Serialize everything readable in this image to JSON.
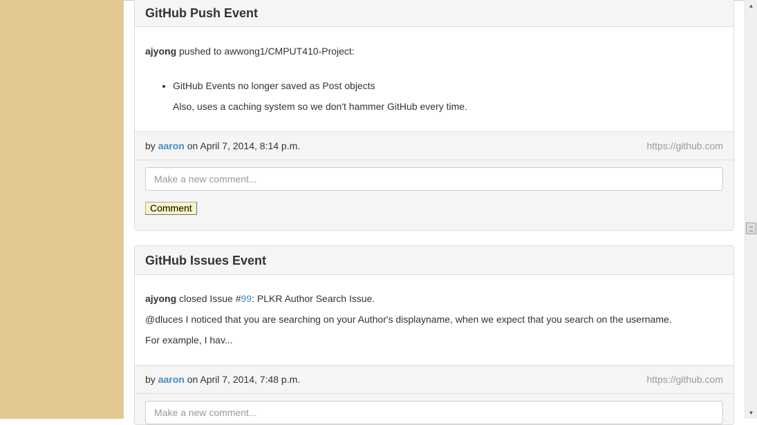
{
  "posts": [
    {
      "title": "GitHub Push Event",
      "actor": "ajyong",
      "action_text": " pushed to awwong1/CMPUT410-Project:",
      "commit_message": "GitHub Events no longer saved as Post objects",
      "commit_detail": "Also, uses a caching system so we don't hammer GitHub every time.",
      "by_label": "by ",
      "author": "aaron",
      "date_text": " on April 7, 2014, 8:14 p.m.",
      "source": "https://github.com",
      "comment_placeholder": "Make a new comment...",
      "comment_button": "Comment"
    },
    {
      "title": "GitHub Issues Event",
      "actor": "ajyong",
      "action_prefix": " closed Issue #",
      "issue_number": "99",
      "action_suffix": ": PLKR Author Search Issue.",
      "body_line_2": "@dluces I noticed that you are searching on your Author's displayname, when we expect that you search on the username.",
      "body_line_3": "For example, I hav...",
      "by_label": "by ",
      "author": "aaron",
      "date_text": " on April 7, 2014, 7:48 p.m.",
      "source": "https://github.com",
      "comment_placeholder": "Make a new comment..."
    }
  ],
  "scrollbar": {
    "up_icon": "arrow-up-icon",
    "down_icon": "arrow-down-icon"
  }
}
